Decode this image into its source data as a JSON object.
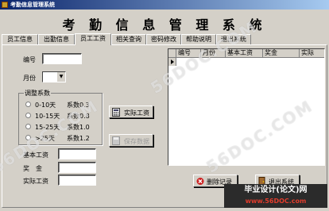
{
  "window": {
    "title": "考勤信息管理系统"
  },
  "header": {
    "title": "考 勤 信 息 管 理 系 统"
  },
  "tabs": [
    {
      "label": "员工信息"
    },
    {
      "label": "出勤信息"
    },
    {
      "label": "员工工资"
    },
    {
      "label": "相关查询"
    },
    {
      "label": "密码修改"
    },
    {
      "label": "帮助说明"
    },
    {
      "label": "退出系统"
    }
  ],
  "active_tab": "员工工资",
  "form": {
    "id_label": "编号",
    "id_value": "",
    "month_label": "月份",
    "month_value": "",
    "group_title": "调整系数",
    "options": [
      {
        "range": "0-10天",
        "coef": "系数0.3"
      },
      {
        "range": "10-15天",
        "coef": "系数0.8"
      },
      {
        "range": "15-25天",
        "coef": "系数1.0"
      },
      {
        "range": ">25天",
        "coef": "系数1.2"
      }
    ],
    "base_salary_label": "基本工资",
    "bonus_label": "奖　金",
    "actual_salary_label": "实际工资",
    "base_salary_value": "",
    "bonus_value": "",
    "actual_salary_value": ""
  },
  "buttons": {
    "actual_salary": "实际工资",
    "save_data": "保存数据",
    "delete_record": "删除记录",
    "exit": "退出系统"
  },
  "table": {
    "columns": [
      "编号",
      "月份",
      "基本工资",
      "奖金",
      "实际"
    ]
  },
  "watermark": {
    "banner_line1": "毕业设计(论文)网",
    "banner_line2": "www.56DOC.com",
    "diagonal_text": "56DOC.COM"
  }
}
